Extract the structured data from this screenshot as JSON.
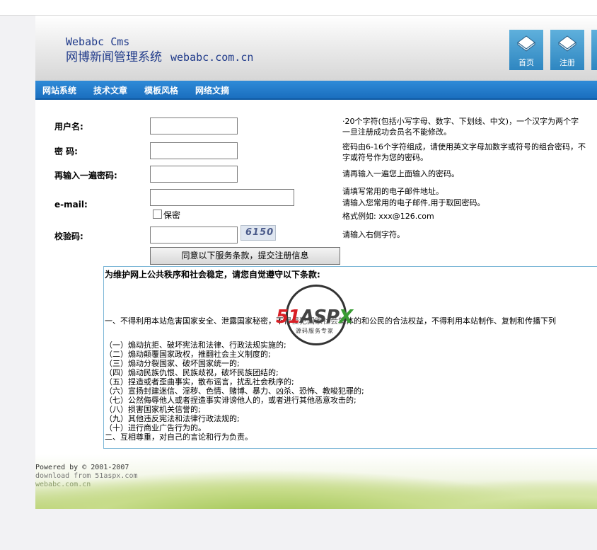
{
  "brand": {
    "name_en": "Webabc Cms",
    "name_cn": "网博新闻管理系统",
    "domain": "webabc.com.cn"
  },
  "header_nav": [
    {
      "label": "首页",
      "icon": "book-icon"
    },
    {
      "label": "注册",
      "icon": "book-icon"
    }
  ],
  "menu": [
    "网站系统",
    "技术文章",
    "模板风格",
    "网络文摘"
  ],
  "form": {
    "username_label": "用户名:",
    "username_hint_1": "·20个字符(包括小写字母、数字、下划线、中文)，一个汉字为两个字",
    "username_hint_2": "一旦注册成功会员名不能修改。",
    "password_label": "密  码:",
    "password_hint_1": "密码由6-16个字符组成，请使用英文字母加数字或符号的组合密码，不",
    "password_hint_2": "字或符号作为您的密码。",
    "confirm_label": "再输入一遍密码:",
    "confirm_hint": "请再输入一遍您上面输入的密码。",
    "email_label": "e-mail:",
    "email_hint_1": "请填写常用的电子邮件地址。",
    "email_hint_2": "请输入您常用的电子邮件,用于取回密码。",
    "email_hint_3": "格式例如: xxx@126.com",
    "secret_label": "保密",
    "captcha_label": "校验码:",
    "captcha_code": "6150",
    "captcha_hint": "请输入右侧字符。",
    "submit_label": "同意以下服务条款，提交注册信息"
  },
  "terms": {
    "title": "为维护网上公共秩序和社会稳定，请您自觉遵守以下条款:",
    "intro": "一、不得利用本站危害国家安全、泄露国家秘密，不得侵犯国家社会集体的和公民的合法权益，不得利用本站制作、复制和传播下列",
    "items": [
      "（一）煽动抗拒、破坏宪法和法律、行政法规实施的;",
      "（二）煽动颠覆国家政权，推翻社会主义制度的;",
      "（三）煽动分裂国家、破坏国家统一的;",
      "（四）煽动民族仇恨、民族歧视，破坏民族团结的;",
      "（五）捏造或者歪曲事实，散布谣言，扰乱社会秩序的;",
      "（六）宣扬封建迷信、淫秽、色情、赌博、暴力、凶杀、恐怖、教唆犯罪的;",
      "（七）公然侮辱他人或者捏造事实诽谤他人的，或者进行其他恶意攻击的;",
      "（八）损害国家机关信誉的;",
      "（九）其他违反宪法和法律行政法规的;",
      "（十）进行商业广告行为的。"
    ],
    "second": "二、互相尊重，对自己的言论和行为负责。"
  },
  "watermark": {
    "part1": "51",
    "part2": "ASP",
    "part3": "X",
    "tagline": "源码服务专家"
  },
  "footer": {
    "line1": "Powered by © 2001-2007",
    "line2": "download from 51aspx.com",
    "line3": "webabc.com.cn"
  },
  "colors": {
    "menu_bg": "#1a6ebf",
    "brand_text": "#1f3a8a",
    "nav_button": "#2e86c1",
    "terms_border": "#7fb8d8"
  }
}
